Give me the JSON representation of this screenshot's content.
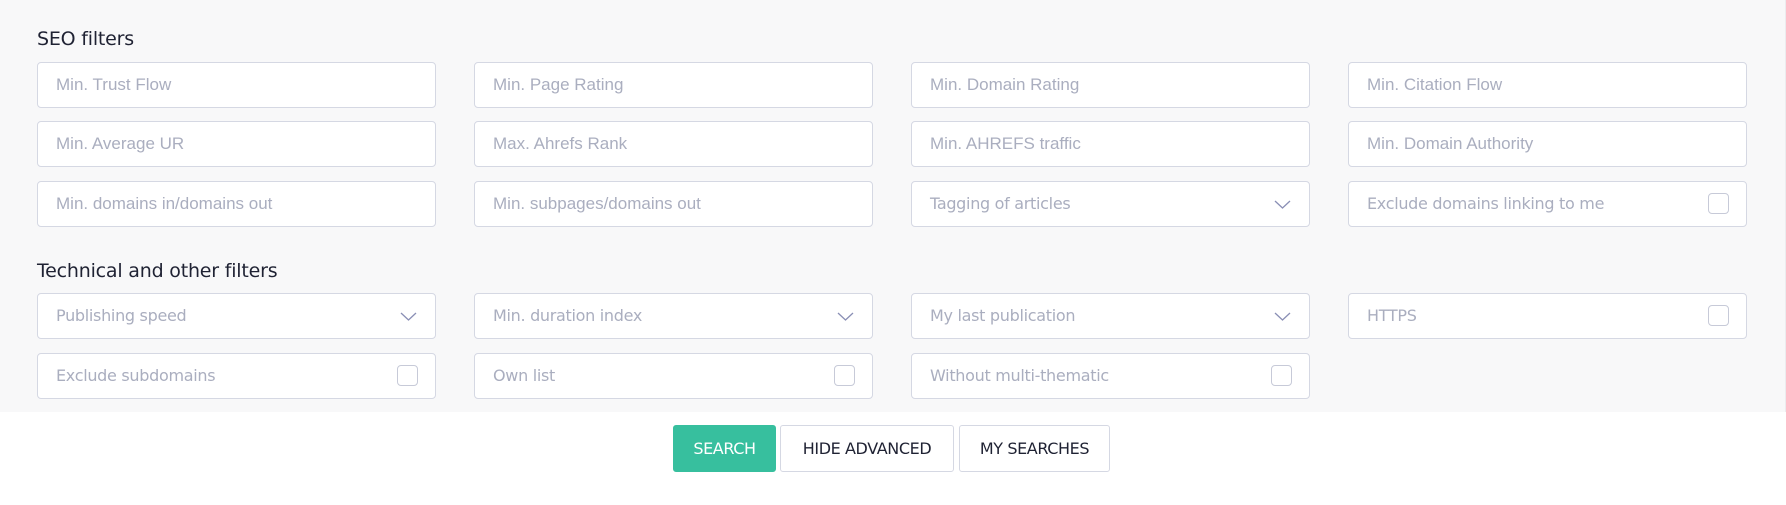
{
  "seo": {
    "title": "SEO filters",
    "fields": [
      {
        "type": "text",
        "placeholder": "Min. Trust Flow"
      },
      {
        "type": "text",
        "placeholder": "Min. Page Rating"
      },
      {
        "type": "text",
        "placeholder": "Min. Domain Rating"
      },
      {
        "type": "text",
        "placeholder": "Min. Citation Flow"
      },
      {
        "type": "text",
        "placeholder": "Min. Average UR"
      },
      {
        "type": "text",
        "placeholder": "Max. Ahrefs Rank"
      },
      {
        "type": "text",
        "placeholder": "Min. AHREFS traffic"
      },
      {
        "type": "text",
        "placeholder": "Min. Domain Authority"
      },
      {
        "type": "text",
        "placeholder": "Min. domains in/domains out"
      },
      {
        "type": "text",
        "placeholder": "Min. subpages/domains out"
      },
      {
        "type": "select",
        "label": "Tagging of articles",
        "icon": "chevron-down-icon"
      },
      {
        "type": "checkbox",
        "label": "Exclude domains linking to me",
        "checked": false
      }
    ]
  },
  "technical": {
    "title": "Technical and other filters",
    "fields": [
      {
        "type": "select",
        "label": "Publishing speed",
        "icon": "chevron-down-icon"
      },
      {
        "type": "select",
        "label": "Min. duration index",
        "icon": "chevron-down-icon"
      },
      {
        "type": "select",
        "label": "My last publication",
        "icon": "chevron-down-icon"
      },
      {
        "type": "checkbox",
        "label": "HTTPS",
        "checked": false
      },
      {
        "type": "checkbox",
        "label": "Exclude subdomains",
        "checked": false
      },
      {
        "type": "checkbox",
        "label": "Own list",
        "checked": false
      },
      {
        "type": "checkbox",
        "label": "Without multi-thematic",
        "checked": false
      }
    ]
  },
  "actions": {
    "search_label": "SEARCH",
    "hide_advanced_label": "HIDE ADVANCED",
    "my_searches_label": "MY SEARCHES"
  },
  "colors": {
    "accent": "#37bf9e",
    "panel_bg": "#f8f8f9",
    "border": "#d5d8e3",
    "placeholder": "#aaaebf",
    "heading": "#1f2233"
  }
}
